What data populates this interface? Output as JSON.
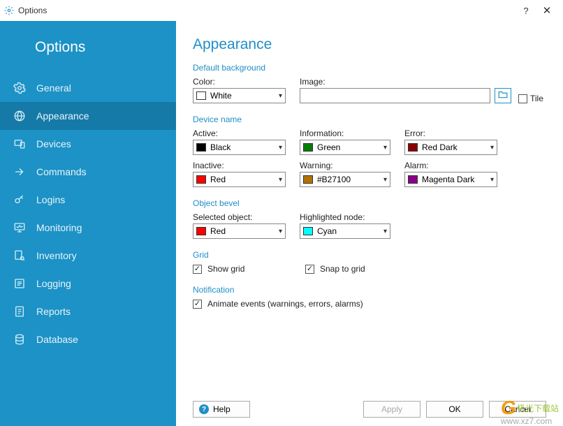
{
  "window": {
    "title": "Options"
  },
  "sidebar": {
    "header": "Options",
    "items": [
      {
        "label": "General"
      },
      {
        "label": "Appearance"
      },
      {
        "label": "Devices"
      },
      {
        "label": "Commands"
      },
      {
        "label": "Logins"
      },
      {
        "label": "Monitoring"
      },
      {
        "label": "Inventory"
      },
      {
        "label": "Logging"
      },
      {
        "label": "Reports"
      },
      {
        "label": "Database"
      }
    ]
  },
  "page": {
    "title": "Appearance"
  },
  "sections": {
    "default_bg": {
      "title": "Default background",
      "color_label": "Color:",
      "color_value": "White",
      "color_swatch": "#ffffff",
      "image_label": "Image:",
      "image_value": "",
      "tile_label": "Tile",
      "tile_checked": false
    },
    "device_name": {
      "title": "Device name",
      "active_label": "Active:",
      "active_value": "Black",
      "active_swatch": "#000000",
      "information_label": "Information:",
      "information_value": "Green",
      "information_swatch": "#008000",
      "error_label": "Error:",
      "error_value": "Red Dark",
      "error_swatch": "#8B0000",
      "inactive_label": "Inactive:",
      "inactive_value": "Red",
      "inactive_swatch": "#ff0000",
      "warning_label": "Warning:",
      "warning_value": "#B27100",
      "warning_swatch": "#B27100",
      "alarm_label": "Alarm:",
      "alarm_value": "Magenta Dark",
      "alarm_swatch": "#8B008B"
    },
    "object_bevel": {
      "title": "Object bevel",
      "selected_label": "Selected object:",
      "selected_value": "Red",
      "selected_swatch": "#ff0000",
      "highlighted_label": "Highlighted node:",
      "highlighted_value": "Cyan",
      "highlighted_swatch": "#00ffff"
    },
    "grid": {
      "title": "Grid",
      "show_label": "Show grid",
      "show_checked": true,
      "snap_label": "Snap to grid",
      "snap_checked": true
    },
    "notification": {
      "title": "Notification",
      "animate_label": "Animate events (warnings, errors, alarms)",
      "animate_checked": true
    }
  },
  "buttons": {
    "help": "Help",
    "apply": "Apply",
    "ok": "OK",
    "cancel": "Cancel"
  },
  "watermark": {
    "cn": "极光下载站",
    "url": "www.xz7.com"
  }
}
